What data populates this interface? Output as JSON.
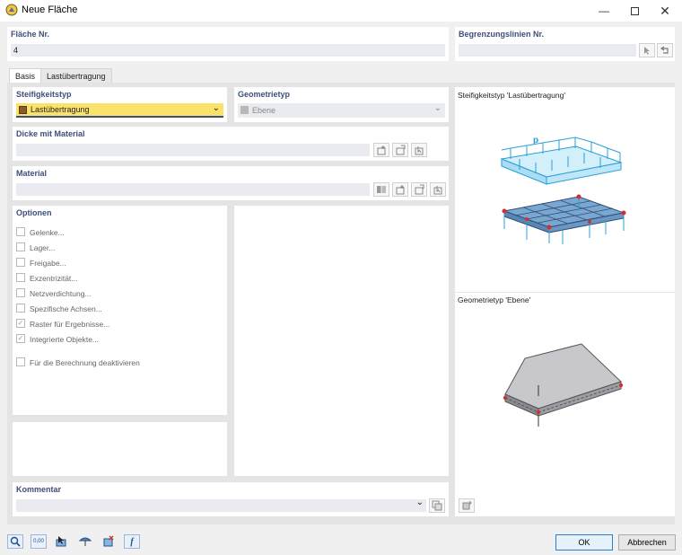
{
  "window": {
    "title": "Neue Fläche"
  },
  "area_no": {
    "label": "Fläche Nr.",
    "value": "4"
  },
  "boundary": {
    "label": "Begrenzungslinien Nr.",
    "value": ""
  },
  "tabs": [
    {
      "label": "Basis"
    },
    {
      "label": "Lastübertragung"
    }
  ],
  "stiffness": {
    "label": "Steifigkeitstyp",
    "value": "Lastübertragung",
    "swatch_color": "#8b5a2b"
  },
  "geometry": {
    "label": "Geometrietyp",
    "value": "Ebene"
  },
  "thickness": {
    "label": "Dicke mit Material",
    "value": ""
  },
  "material": {
    "label": "Material",
    "value": ""
  },
  "options": {
    "label": "Optionen",
    "items": [
      {
        "label": "Gelenke...",
        "checked": false
      },
      {
        "label": "Lager...",
        "checked": false
      },
      {
        "label": "Freigabe...",
        "checked": false
      },
      {
        "label": "Exzentrizität...",
        "checked": false
      },
      {
        "label": "Netzverdichtung...",
        "checked": false
      },
      {
        "label": "Spezifische Achsen...",
        "checked": false
      },
      {
        "label": "Raster für Ergebnisse...",
        "checked": true
      },
      {
        "label": "Integrierte Objekte...",
        "checked": true
      }
    ],
    "deactivate": {
      "label": "Für die Berechnung deaktivieren",
      "checked": false
    }
  },
  "comment": {
    "label": "Kommentar",
    "value": ""
  },
  "preview": {
    "stiffness_title": "Steifigkeitstyp 'Lastübertragung'",
    "load_symbol": "p",
    "geometry_title": "Geometrietyp 'Ebene'"
  },
  "buttons": {
    "ok": "OK",
    "cancel": "Abbrechen"
  },
  "bottom_toolbar": {
    "value_display": "0,00"
  },
  "colors": {
    "accent": "#3d4f78",
    "highlight": "#fbe26a",
    "load_blue": "#2a9fd8",
    "node_red": "#d32f2f"
  }
}
